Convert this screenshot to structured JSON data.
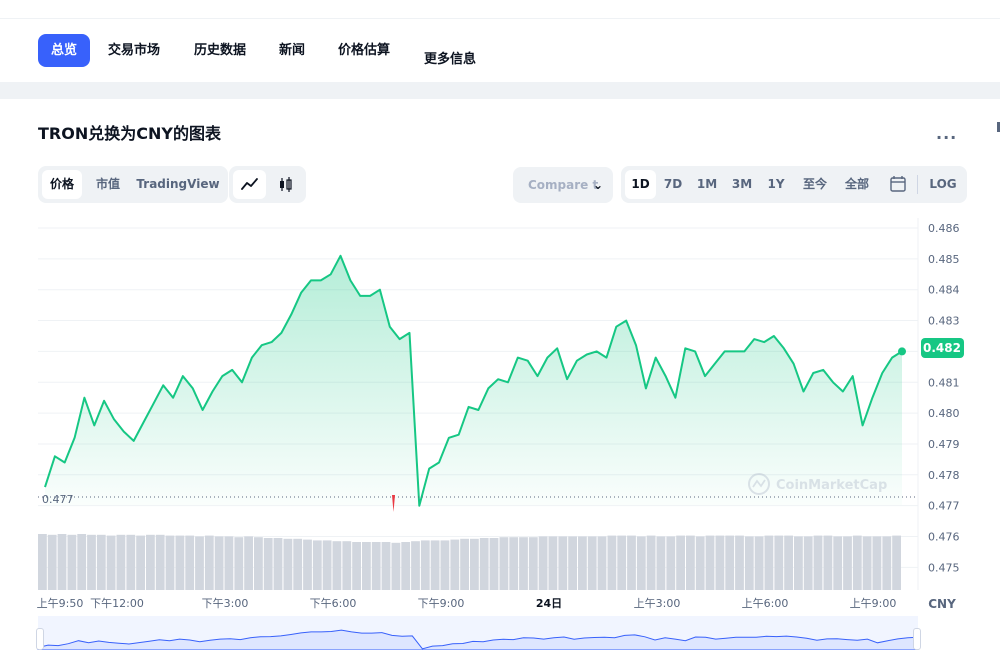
{
  "nav": {
    "tabs": [
      {
        "label": "总览",
        "active": true
      },
      {
        "label": "交易市场"
      },
      {
        "label": "历史数据"
      },
      {
        "label": "新闻"
      },
      {
        "label": "价格估算"
      },
      {
        "label": "更多信息"
      }
    ]
  },
  "title": "TRON兑换为CNY的图表",
  "more_label": "...",
  "controls": {
    "type_tabs": [
      "价格",
      "市值",
      "TradingView"
    ],
    "selected_type": "价格",
    "chart_style": [
      "line-chart-icon",
      "candlestick-icon"
    ],
    "selected_style": "line-chart-icon",
    "compare_label": "Compare t",
    "ranges": [
      "1D",
      "7D",
      "1M",
      "3M",
      "1Y",
      "至今",
      "全部"
    ],
    "selected_range": "1D",
    "calendar_icon": "calendar-icon",
    "log_label": "LOG"
  },
  "colors": {
    "accent": "#3861fb",
    "line": "#16c784",
    "low": "#ea3943",
    "text": "#0d1421",
    "muted": "#58667e"
  },
  "chart_data": {
    "type": "line",
    "y_ticks": [
      "0.486",
      "0.485",
      "0.484",
      "0.483",
      "0.482",
      "0.481",
      "0.480",
      "0.479",
      "0.478",
      "0.477",
      "0.476",
      "0.475"
    ],
    "ylim": [
      0.4745,
      0.4865
    ],
    "current_price_label": "0.482",
    "low_label": "0.477",
    "x_ticks": [
      "上午9:50",
      "下午12:00",
      "下午3:00",
      "下午6:00",
      "下午9:00",
      "24日",
      "上午3:00",
      "上午6:00",
      "上午9:00"
    ],
    "x_unit_label": "CNY",
    "watermark": "CoinMarketCap",
    "series": [
      {
        "values": [
          0.4776,
          0.4786,
          0.4784,
          0.4792,
          0.4805,
          0.4796,
          0.4804,
          0.4798,
          0.4794,
          0.4791,
          0.4797,
          0.4803,
          0.4809,
          0.4805,
          0.4812,
          0.4808,
          0.4801,
          0.4807,
          0.4812,
          0.4814,
          0.481,
          0.4818,
          0.4822,
          0.4823,
          0.4826,
          0.4832,
          0.4839,
          0.4843,
          0.4843,
          0.4845,
          0.4851,
          0.4843,
          0.4838,
          0.4838,
          0.484,
          0.4828,
          0.4824,
          0.4826,
          0.477,
          0.4782,
          0.4784,
          0.4792,
          0.4793,
          0.4802,
          0.4801,
          0.4808,
          0.4811,
          0.481,
          0.4818,
          0.4817,
          0.4812,
          0.4818,
          0.4821,
          0.4811,
          0.4817,
          0.4819,
          0.482,
          0.4818,
          0.4828,
          0.483,
          0.4822,
          0.4808,
          0.4818,
          0.4812,
          0.4805,
          0.4821,
          0.482,
          0.4812,
          0.4816,
          0.482,
          0.482,
          0.482,
          0.4824,
          0.4823,
          0.4825,
          0.4821,
          0.4816,
          0.4807,
          0.4813,
          0.4814,
          0.481,
          0.4807,
          0.4812,
          0.4796,
          0.4805,
          0.4813,
          0.4818,
          0.482
        ]
      }
    ],
    "volume": [
      0.7,
      0.69,
      0.7,
      0.69,
      0.7,
      0.69,
      0.69,
      0.68,
      0.69,
      0.69,
      0.68,
      0.69,
      0.69,
      0.68,
      0.68,
      0.68,
      0.67,
      0.68,
      0.67,
      0.67,
      0.66,
      0.67,
      0.66,
      0.65,
      0.65,
      0.64,
      0.64,
      0.63,
      0.62,
      0.62,
      0.61,
      0.61,
      0.6,
      0.6,
      0.6,
      0.6,
      0.59,
      0.6,
      0.61,
      0.62,
      0.62,
      0.62,
      0.63,
      0.64,
      0.64,
      0.65,
      0.65,
      0.66,
      0.66,
      0.66,
      0.66,
      0.67,
      0.67,
      0.67,
      0.67,
      0.67,
      0.67,
      0.67,
      0.68,
      0.68,
      0.68,
      0.67,
      0.68,
      0.67,
      0.67,
      0.68,
      0.68,
      0.67,
      0.68,
      0.68,
      0.68,
      0.68,
      0.67,
      0.67,
      0.68,
      0.68,
      0.68,
      0.67,
      0.67,
      0.68,
      0.68,
      0.67,
      0.67,
      0.68,
      0.67,
      0.67,
      0.67,
      0.68
    ]
  }
}
